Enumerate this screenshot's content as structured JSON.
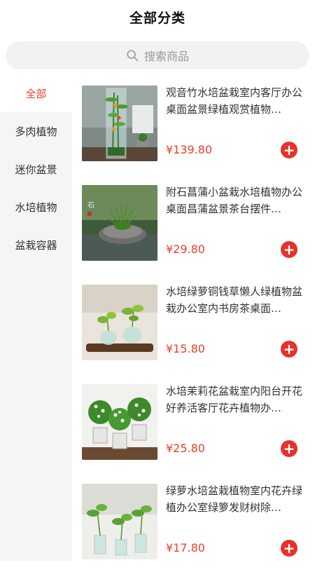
{
  "header": {
    "title": "全部分类"
  },
  "search": {
    "placeholder": "搜索商品",
    "icon": "search-icon"
  },
  "sidebar": {
    "items": [
      {
        "label": "全部",
        "active": true
      },
      {
        "label": "多肉植物",
        "active": false
      },
      {
        "label": "迷你盆景",
        "active": false
      },
      {
        "label": "水培植物",
        "active": false
      },
      {
        "label": "盆栽容器",
        "active": false
      }
    ]
  },
  "products": [
    {
      "name": "观音竹水培盆栽室内客厅办公桌面盆景绿植观赏植物…",
      "price": "¥139.80"
    },
    {
      "name": "附石菖蒲小盆栽水培植物办公桌面昌蒲盆景茶台摆件…",
      "price": "¥29.80"
    },
    {
      "name": "水培绿萝铜钱草懒人绿植物盆栽办公室内书房茶桌面…",
      "price": "¥15.80"
    },
    {
      "name": "水培茉莉花盆栽室内阳台开花好养活客厅花卉植物办…",
      "price": "¥25.80"
    },
    {
      "name": "绿萝水培盆栽植物室内花卉绿植办公室绿箩发财树除…",
      "price": "¥17.80"
    }
  ],
  "colors": {
    "accent": "#e8412a",
    "sidebar_bg": "#f5f5f5",
    "search_bg": "#f2f2f2"
  }
}
